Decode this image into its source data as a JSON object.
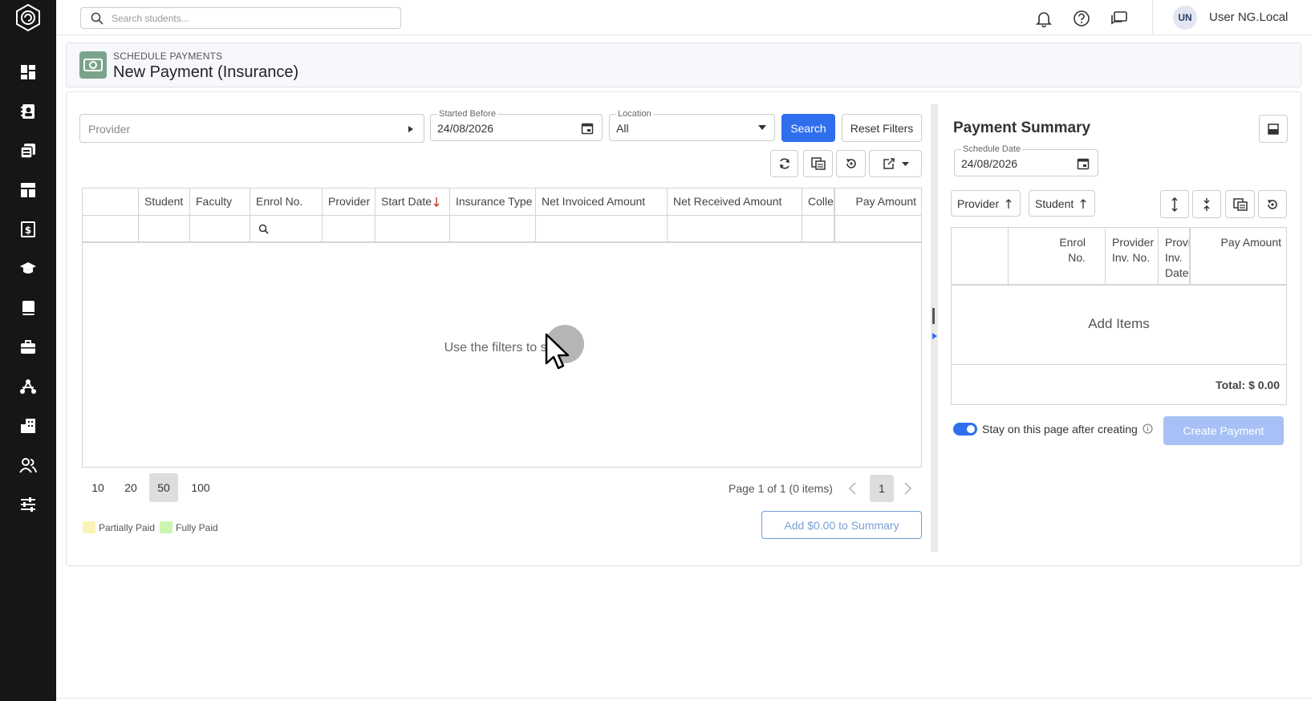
{
  "topbar": {
    "search_placeholder": "Search students...",
    "user_initials": "UN",
    "user_name": "User NG.Local"
  },
  "sidebar": {
    "icons": [
      "dashboard-icon",
      "students-icon",
      "documents-icon",
      "layout-icon",
      "payments-icon",
      "graduation-icon",
      "book-icon",
      "briefcase-icon",
      "network-icon",
      "building-icon",
      "users-icon",
      "settings-sliders-icon"
    ]
  },
  "header": {
    "kicker": "SCHEDULE PAYMENTS",
    "title": "New Payment (Insurance)"
  },
  "filters": {
    "provider_placeholder": "Provider",
    "started_before_label": "Started Before",
    "started_before_value": "24/08/2026",
    "location_label": "Location",
    "location_value": "All",
    "search_label": "Search",
    "reset_label": "Reset Filters"
  },
  "grid": {
    "columns": [
      "Student",
      "Faculty",
      "Enrol No.",
      "Provider",
      "Start Date",
      "Insurance Type",
      "Net Invoiced Amount",
      "Net Received Amount",
      "Colle",
      "Pay Amount"
    ],
    "empty_message": "Use the filters to sea"
  },
  "pager": {
    "sizes": [
      "10",
      "20",
      "50",
      "100"
    ],
    "active_size": "50",
    "info": "Page 1 of 1 (0 items)",
    "current_page": "1"
  },
  "legend": {
    "partially_paid": "Partially Paid",
    "fully_paid": "Fully Paid",
    "partially_color": "#fbf3b5",
    "fully_color": "#cdf5b0"
  },
  "add_to_summary": "Add $0.00 to Summary",
  "summary": {
    "title": "Payment Summary",
    "schedule_date_label": "Schedule Date",
    "schedule_date_value": "24/08/2026",
    "sort_provider": "Provider",
    "sort_student": "Student",
    "col_enrol": [
      "Enrol",
      "No."
    ],
    "col_provider_inv": [
      "Provider",
      "Inv. No."
    ],
    "col_provider_inv_date": [
      "Provi",
      "Inv.",
      "Date"
    ],
    "col_pay_amount": "Pay Amount",
    "empty": "Add Items",
    "total": "Total: $ 0.00",
    "stay_label": "Stay on this page after creating",
    "create_label": "Create Payment"
  },
  "colors": {
    "sidebar": "#161616",
    "primary": "#2f6fee",
    "header_icon": "#7aa38c"
  }
}
